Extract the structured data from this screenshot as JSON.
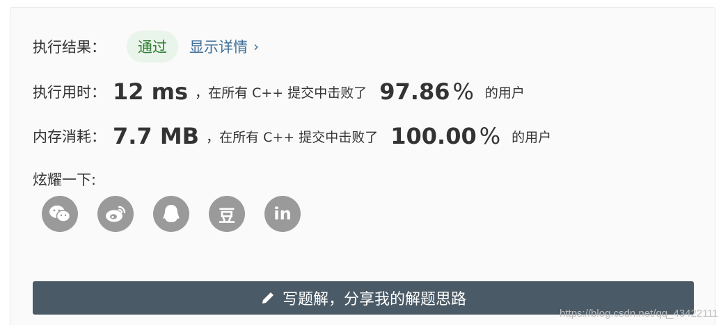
{
  "result": {
    "label": "执行结果：",
    "status": "通过",
    "detail_link": "显示详情",
    "status_color": "#2f7d32",
    "status_bg": "#e9f4ea"
  },
  "runtime": {
    "label": "执行用时：",
    "value": "12 ms",
    "text_before": "，在所有 C++ 提交中击败了",
    "percent": "97.86",
    "percent_sign": "%",
    "text_after": "的用户"
  },
  "memory": {
    "label": "内存消耗：",
    "value": "7.7 MB",
    "text_before": "，在所有 C++ 提交中击败了",
    "percent": "100.00",
    "percent_sign": "%",
    "text_after": "的用户"
  },
  "share": {
    "label": "炫耀一下:",
    "icons": [
      {
        "name": "wechat-icon"
      },
      {
        "name": "weibo-icon"
      },
      {
        "name": "qq-icon"
      },
      {
        "name": "douban-icon",
        "glyph": "豆"
      },
      {
        "name": "linkedin-icon",
        "glyph": "in"
      }
    ]
  },
  "write_solution": {
    "label": "写题解，分享我的解题思路",
    "icon": "pencil-icon",
    "bg_color": "#4a5a66"
  },
  "watermark": "https://blog.csdn.net/qq_43422111"
}
